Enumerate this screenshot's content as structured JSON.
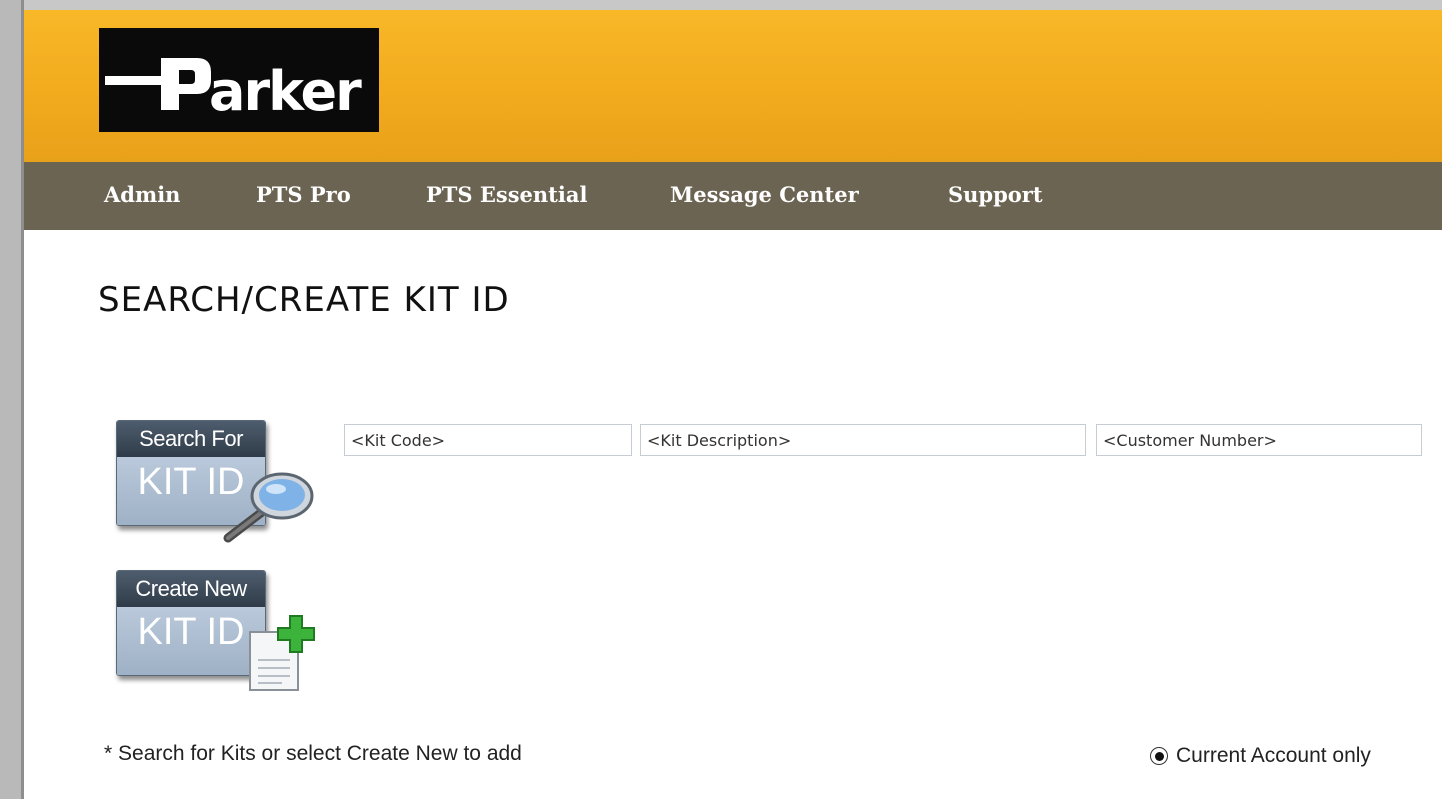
{
  "brand": {
    "logo_text": "Parker",
    "colors": {
      "header": "#f2ab1d",
      "nav": "#6c6452"
    }
  },
  "nav": {
    "items": [
      {
        "label": "Admin"
      },
      {
        "label": "PTS Pro"
      },
      {
        "label": "PTS Essential"
      },
      {
        "label": "Message Center"
      },
      {
        "label": "Support"
      }
    ]
  },
  "page": {
    "title": "SEARCH/CREATE KIT ID"
  },
  "search_tile": {
    "top_label": "Search For",
    "bottom_label": "KIT ID",
    "icon": "magnifier-icon"
  },
  "create_tile": {
    "top_label": "Create New",
    "bottom_label": "KIT ID",
    "icon": "add-document-icon"
  },
  "search": {
    "kit_code_placeholder": "<Kit Code>",
    "kit_description_placeholder": "<Kit Description>",
    "customer_number_placeholder": "<Customer Number>"
  },
  "footer": {
    "note": "* Search for Kits or select Create New to add",
    "radio_label": "Current Account only",
    "radio_selected": true
  }
}
